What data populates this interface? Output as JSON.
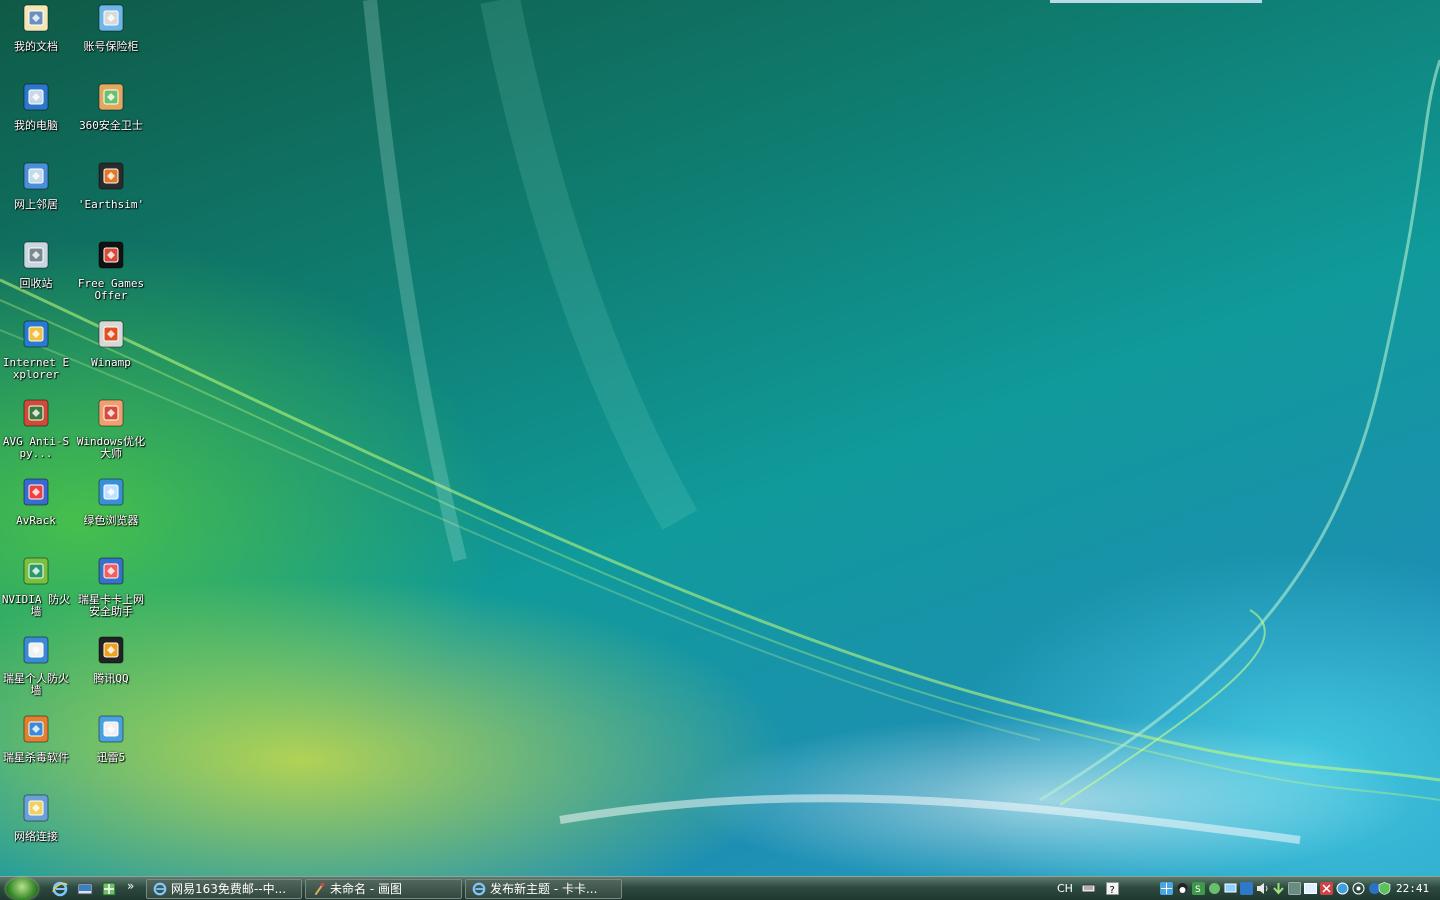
{
  "desktop_icons": [
    {
      "name": "icon-my-documents",
      "label": "我的文档",
      "glyph": "documents-icon"
    },
    {
      "name": "icon-account-safe",
      "label": "账号保险柜",
      "glyph": "safe-icon"
    },
    {
      "name": "icon-my-computer",
      "label": "我的电脑",
      "glyph": "computer-icon"
    },
    {
      "name": "icon-360-safeguard",
      "label": "360安全卫士",
      "glyph": "shield-app-icon"
    },
    {
      "name": "icon-network-places",
      "label": "网上邻居",
      "glyph": "network-icon"
    },
    {
      "name": "icon-earthsim",
      "label": "'Earthsim'",
      "glyph": "earth-icon"
    },
    {
      "name": "icon-recycle-bin",
      "label": "回收站",
      "glyph": "recycle-bin-icon"
    },
    {
      "name": "icon-free-games",
      "label": "Free Games Offer",
      "glyph": "games-icon"
    },
    {
      "name": "icon-internet-explorer",
      "label": "Internet Explorer",
      "glyph": "ie-icon"
    },
    {
      "name": "icon-winamp",
      "label": "Winamp",
      "glyph": "winamp-icon"
    },
    {
      "name": "icon-avg-antispy",
      "label": "AVG Anti-Spy...",
      "glyph": "avg-icon"
    },
    {
      "name": "icon-windows-optimizer",
      "label": "Windows优化大师",
      "glyph": "optimizer-icon"
    },
    {
      "name": "icon-avrack",
      "label": "AvRack",
      "glyph": "avrack-icon"
    },
    {
      "name": "icon-green-browser",
      "label": "绿色浏览器",
      "glyph": "browser-icon"
    },
    {
      "name": "icon-nvidia-firewall",
      "label": "NVIDIA 防火墙",
      "glyph": "nvidia-icon"
    },
    {
      "name": "icon-rising-card",
      "label": "瑞星卡卡上网安全助手",
      "glyph": "rising-card-icon"
    },
    {
      "name": "icon-rising-firewall",
      "label": "瑞星个人防火墙",
      "glyph": "firewall-icon"
    },
    {
      "name": "icon-tencent-qq",
      "label": "腾讯QQ",
      "glyph": "qq-penguin-icon"
    },
    {
      "name": "icon-rising-antivirus",
      "label": "瑞星杀毒软件",
      "glyph": "antivirus-icon"
    },
    {
      "name": "icon-xunlei",
      "label": "迅雷5",
      "glyph": "xunlei-icon"
    },
    {
      "name": "icon-network-connections",
      "label": "网络连接",
      "glyph": "network-connections-icon"
    }
  ],
  "taskbar": {
    "quick_launch": [
      "ie-icon",
      "show-desktop-icon",
      "network-quicklaunch-icon"
    ],
    "more_chevron": "»",
    "tasks": [
      {
        "label": "网易163免费邮--中...",
        "icon": "ie-icon"
      },
      {
        "label": "未命名 - 画图",
        "icon": "paint-icon"
      },
      {
        "label": "发布新主题 - 卡卡...",
        "icon": "ie-icon"
      }
    ],
    "tray": {
      "language": "CH",
      "clock": "22:41"
    }
  },
  "colors": {
    "label_text": "#ffffff",
    "taskbar_top": "#5d7b6e",
    "taskbar_bottom": "#1f3830"
  }
}
